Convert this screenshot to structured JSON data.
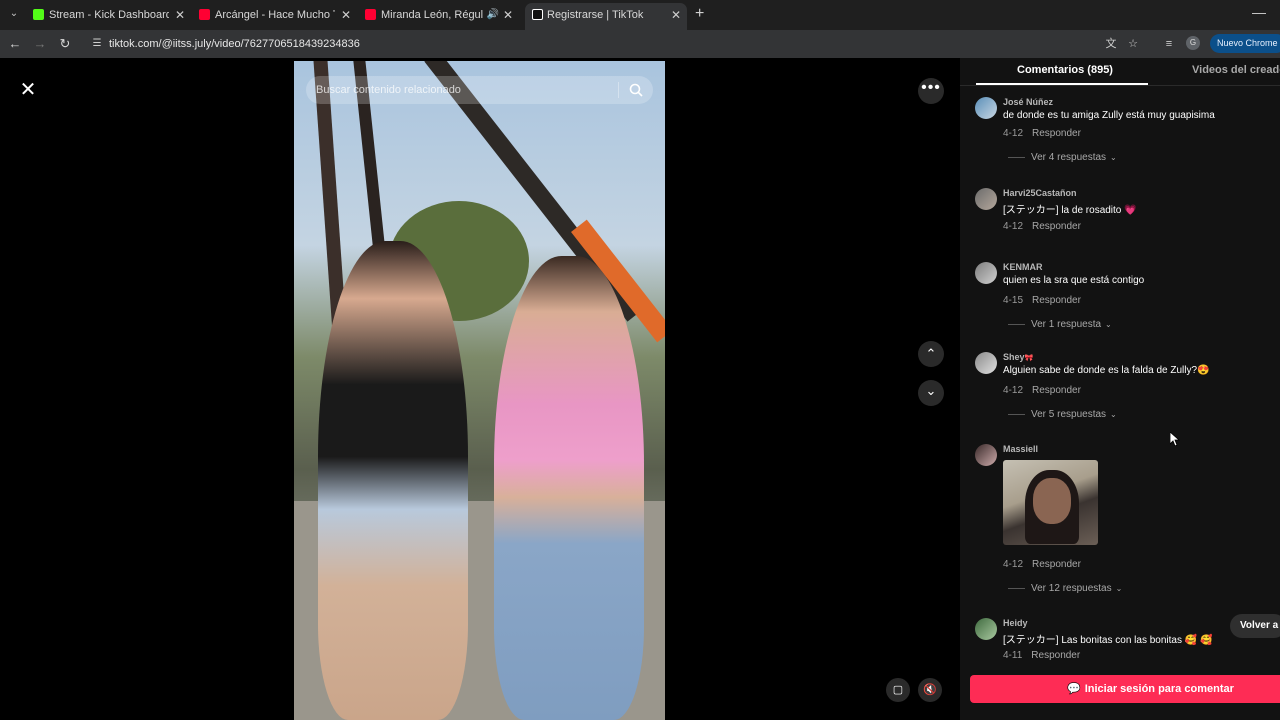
{
  "browser": {
    "tabs": [
      {
        "title": "Stream - Kick Dashboard",
        "favicon": "kick-icon",
        "color": "#53fc18",
        "active": false
      },
      {
        "title": "Arcángel - Hace Mucho Tiempo",
        "favicon": "youtube-icon",
        "color": "#ff0033",
        "active": false
      },
      {
        "title": "Miranda León, Régulo Molina",
        "favicon": "youtube-icon",
        "color": "#ff0033",
        "active": false
      },
      {
        "title": "Registrarse | TikTok",
        "favicon": "tiktok-icon",
        "color": "#ffffff",
        "active": true
      }
    ],
    "url": "tiktok.com/@iitss.july/video/7627706518439234836",
    "new_chrome_label": "Nuevo Chrome d",
    "profile_initial": "G"
  },
  "video": {
    "search_placeholder": "Buscar contenido relacionado"
  },
  "panel": {
    "tab_comments": "Comentarios (895)",
    "tab_creator_videos": "Videos del creador",
    "reply_label": "Responder",
    "comments": [
      {
        "user": "José Núñez",
        "text": "de donde es tu amiga Zully está muy guapisima",
        "date": "4-12",
        "more": "Ver 4 respuestas"
      },
      {
        "user": "Harvi25Castañon",
        "text": "[ステッカー] la de rosadito ",
        "emoji": "💗",
        "date": "4-12"
      },
      {
        "user": "KENMAR",
        "text": "quien es la sra que está contigo",
        "date": "4-15",
        "more": "Ver 1 respuesta"
      },
      {
        "user": "Shey",
        "user_emoji": "🎀",
        "text": "Alguien sabe de donde es la falda de Zully?",
        "emoji": "😍",
        "date": "4-12",
        "more": "Ver 5 respuestas"
      },
      {
        "user": "Massiell",
        "date": "4-12",
        "more": "Ver 12 respuestas"
      },
      {
        "user": "Heidy",
        "text": "[ステッカー] Las bonitas con las bonitas ",
        "emoji": "🥰 🥰",
        "date": "4-11"
      }
    ],
    "back_to_top": "Volver a",
    "login_button": "Iniciar sesión para comentar"
  }
}
